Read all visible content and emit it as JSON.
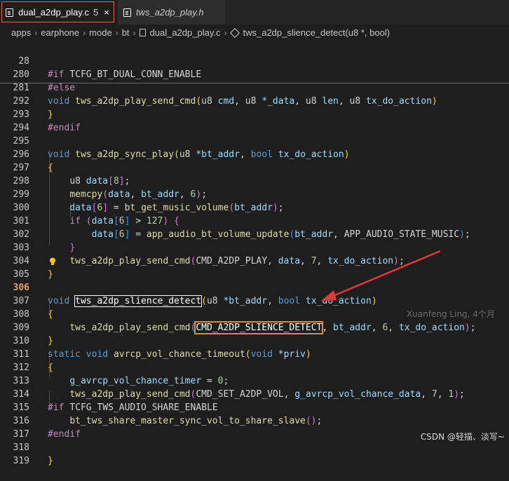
{
  "tabs": [
    {
      "name": "dual_a2dp_play.c",
      "badge": "5",
      "close": "×"
    },
    {
      "name": "tws_a2dp_play.h"
    }
  ],
  "breadcrumb": [
    "apps",
    "earphone",
    "mode",
    "bt",
    "dual_a2dp_play.c",
    "tws_a2dp_slience_detect(u8 *, bool)"
  ],
  "lines": {
    "l28": "28",
    "l280": "280",
    "l281": "281",
    "l292": "292",
    "l293": "293",
    "l294": "294",
    "l295": "295",
    "l296": "296",
    "l297": "297",
    "l298": "298",
    "l299": "299",
    "l300": "300",
    "l301": "301",
    "l302": "302",
    "l303": "303",
    "l304": "304",
    "l305": "305",
    "l306": "306",
    "l307": "307",
    "l308": "308",
    "l309": "309",
    "l310": "310",
    "l311": "311",
    "l312": "312",
    "l313": "313",
    "l314": "314",
    "l315": "315",
    "l316": "316",
    "l317": "317",
    "l318": "318",
    "l319": "319"
  },
  "code": {
    "if_dir": "#if",
    "macro_dual": "TCFG_BT_DUAL_CONN_ENABLE",
    "else_dir": "#else",
    "void": "void",
    "fn_send_cmd": "tws_a2dp_play_send_cmd",
    "u8": "u8",
    "cmd": "cmd",
    "star_data": "*_data",
    "len": "len",
    "tx": "tx_do_action",
    "endif_dir": "#endif",
    "fn_sync_play": "tws_a2dp_sync_play",
    "star_bt_addr": "*bt_addr",
    "bool": "bool",
    "data": "data",
    "n8": "8",
    "memcpy": "memcpy",
    "bt_addr": "bt_addr",
    "n6": "6",
    "bt_get_music_volume": "bt_get_music_volume",
    "if_kw": "if",
    "n127": "127",
    "app_audio_bt_volume_update": "app_audio_bt_volume_update",
    "APP_AUDIO_STATE_MUSIC": "APP_AUDIO_STATE_MUSIC",
    "CMD_A2DP_PLAY": "CMD_A2DP_PLAY",
    "n7": "7",
    "fn_slience_detect": "tws_a2dp_slience_detect",
    "CMD_A2DP_SLIENCE_DETECT": "CMD_A2DP_SLIENCE_DETECT",
    "static": "static",
    "fn_avrcp": "avrcp_vol_chance_timeout",
    "star_priv": "*priv",
    "g_timer": "g_avrcp_vol_chance_timer",
    "n0": "0",
    "CMD_SET_A2DP_VOL": "CMD_SET_A2DP_VOL",
    "g_data": "g_avrcp_vol_chance_data",
    "n1": "1",
    "macro_share": "TCFG_TWS_AUDIO_SHARE_ENABLE",
    "fn_share": "bt_tws_share_master_sync_vol_to_share_slave"
  },
  "blame": "Xuanfeng Ling, 4个月",
  "watermark": "CSDN @轻描、淡写~",
  "colors": {
    "keyword": "#569cd6",
    "function": "#dcdcaa",
    "variable": "#9cdcfe",
    "macro": "#4fc1ff",
    "number": "#b5cea8",
    "directive": "#c586c0",
    "arrow": "#e53935",
    "highlight_box": "#e8892f"
  }
}
